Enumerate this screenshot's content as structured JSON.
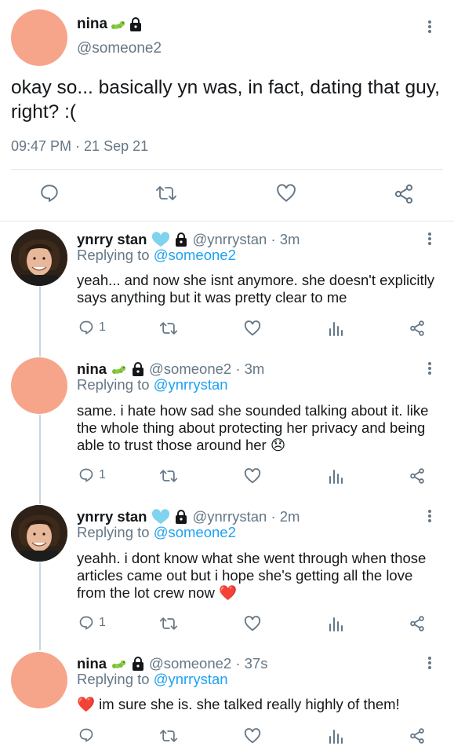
{
  "main": {
    "name": "nina",
    "handle": "@someone2",
    "text": "okay so... basically yn was, in fact, dating that guy, right? :(",
    "timestamp": "09:47 PM · 21 Sep 21"
  },
  "replies": [
    {
      "name": "ynrry stan",
      "handle_time": "@ynrrystan · 3m",
      "replying_prefix": "Replying to",
      "replying_to": "@someone2",
      "text": "yeah... and now she isnt anymore. she doesn't explicitly says anything but it was pretty clear to me",
      "reply_count": "1"
    },
    {
      "name": "nina",
      "handle_time": "@someone2 · 3m",
      "replying_prefix": "Replying to",
      "replying_to": "@ynrrystan",
      "text": "same. i hate how sad she sounded talking about it. like the whole thing about protecting her privacy and being able to trust those around her 😞",
      "reply_count": "1"
    },
    {
      "name": "ynrry stan",
      "handle_time": "@ynrrystan · 2m",
      "replying_prefix": "Replying to",
      "replying_to": "@someone2",
      "text": "yeahh. i dont know what she went through when those articles came out but i hope she's getting all the love from the lot crew now ❤️",
      "reply_count": "1"
    },
    {
      "name": "nina",
      "handle_time": "@someone2 · 37s",
      "replying_prefix": "Replying to",
      "replying_to": "@ynrrystan",
      "text": "❤️ im sure she is. she talked really highly of them!",
      "reply_count": ""
    }
  ],
  "colors": {
    "accent": "#1da1f2",
    "muted": "#657786",
    "avatar_pink": "#f6a58b",
    "verified_heart": "#7fd3ee"
  },
  "icons": [
    "reply-icon",
    "retweet-icon",
    "like-icon",
    "share-icon",
    "analytics-icon",
    "more-icon",
    "lock-icon",
    "caterpillar-emoji",
    "light-blue-heart-emoji"
  ]
}
